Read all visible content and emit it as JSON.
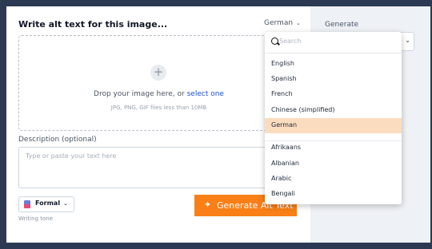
{
  "form": {
    "title": "Write alt text for this image...",
    "language_selected": "German",
    "drop_text": "Drop your image here, or",
    "drop_link": "select one",
    "drop_hint": "JPG, PNG, GIF files less than 10MB",
    "description_label": "Description (optional)",
    "description_placeholder": "Type or paste your text here",
    "tone_value": "Formal",
    "tone_caption": "Writing tone",
    "generate_label": "Generate Alt Text"
  },
  "sidebar": {
    "title": "Generate"
  },
  "dropdown": {
    "search_placeholder": "Search",
    "items": [
      "English",
      "Spanish",
      "French",
      "Chinese (simplified)",
      "German"
    ],
    "items_more": [
      "Afrikaans",
      "Albanian",
      "Arabic",
      "Bengali"
    ],
    "selected_index": 4
  },
  "icons": {
    "language_chevron": "chevron-down-icon",
    "tone": "tone-flag-icon",
    "generate": "sparkle-icon",
    "search": "search-icon",
    "upload": "plus-icon"
  },
  "colors": {
    "accent": "#f97f16",
    "link": "#1d4ed8",
    "selected_item": "#fcdcbf"
  }
}
